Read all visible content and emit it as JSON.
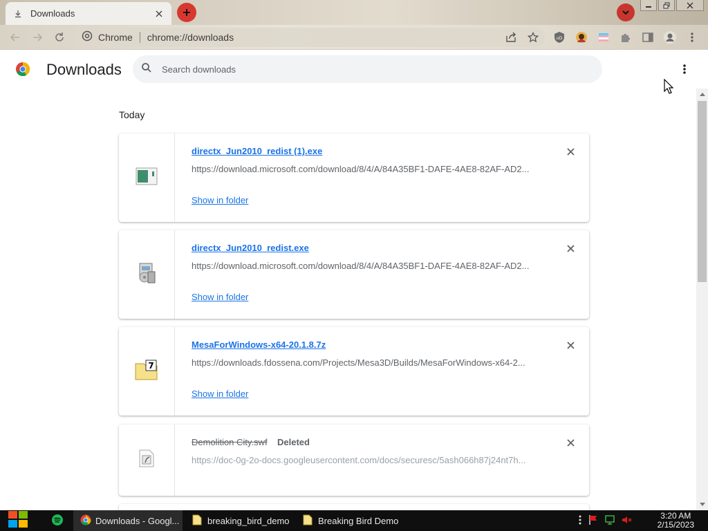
{
  "browser": {
    "tab_title": "Downloads",
    "omnibox_site": "Chrome",
    "omnibox_url": "chrome://downloads"
  },
  "page": {
    "title": "Downloads",
    "search_placeholder": "Search downloads",
    "section_label": "Today"
  },
  "downloads": [
    {
      "name": "directx_Jun2010_redist (1).exe",
      "url": "https://download.microsoft.com/download/8/4/A/84A35BF1-DAFE-4AE8-82AF-AD2...",
      "action": "Show in folder",
      "icon": "installer-file-icon"
    },
    {
      "name": "directx_Jun2010_redist.exe",
      "url": "https://download.microsoft.com/download/8/4/A/84A35BF1-DAFE-4AE8-82AF-AD2...",
      "action": "Show in folder",
      "icon": "setup-exe-icon"
    },
    {
      "name": "MesaForWindows-x64-20.1.8.7z",
      "url": "https://downloads.fdossena.com/Projects/Mesa3D/Builds/MesaForWindows-x64-2...",
      "action": "Show in folder",
      "icon": "7z-archive-icon"
    },
    {
      "name": "Demolition City.swf",
      "status": "Deleted",
      "url": "https://doc-0g-2o-docs.googleusercontent.com/docs/securesc/5ash066h87j24nt7h...",
      "icon": "flash-file-icon"
    }
  ],
  "taskbar": {
    "apps": [
      {
        "label": "Downloads - Googl..."
      },
      {
        "label": "breaking_bird_demo"
      },
      {
        "label": "Breaking Bird Demo"
      }
    ],
    "time": "3:20 AM",
    "date": "2/15/2023"
  },
  "colors": {
    "link": "#1a73e8",
    "accent_red": "#d7372f",
    "text_primary": "#202124",
    "text_secondary": "#5f6368"
  }
}
